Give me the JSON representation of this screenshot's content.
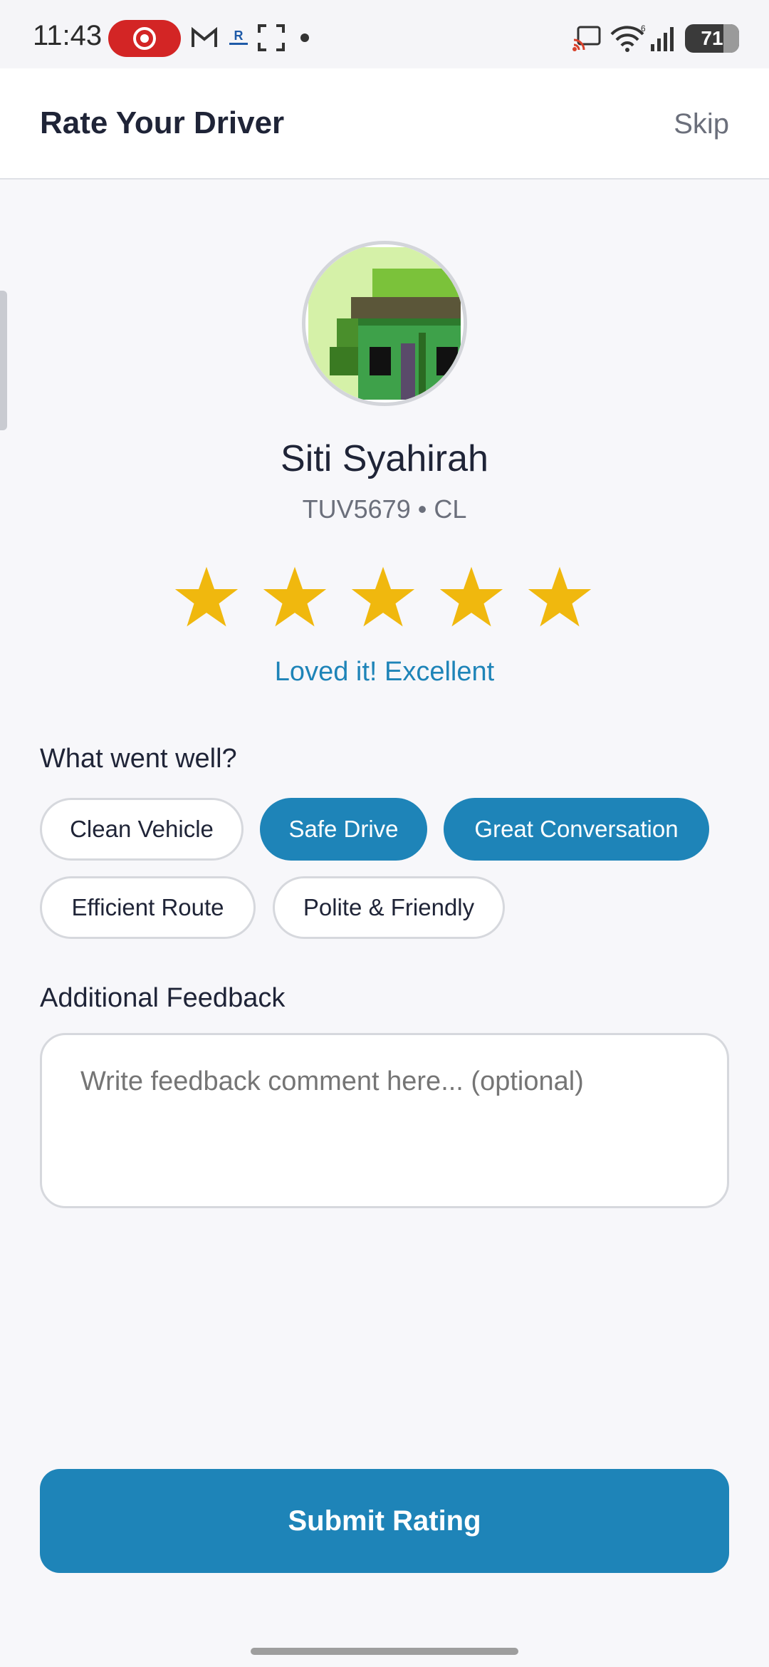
{
  "status_bar": {
    "time": "11:43",
    "battery_level": "71",
    "signal_label": "6",
    "icons": [
      "screen-record-icon",
      "gmail-icon",
      "app-r-icon",
      "screenshot-icon",
      "dot-icon",
      "cast-icon",
      "wifi-icon",
      "signal-icon",
      "battery-icon"
    ]
  },
  "header": {
    "title": "Rate Your Driver",
    "skip_label": "Skip"
  },
  "driver": {
    "name": "Siti Syahirah",
    "plate": "TUV5679 • CL",
    "avatar_icon": "pixel-avatar"
  },
  "rating": {
    "stars_selected": 5,
    "stars_total": 5,
    "label": "Loved it! Excellent",
    "star_color": "#F0B80E"
  },
  "what_went_well": {
    "title": "What went well?",
    "chips": [
      {
        "label": "Clean Vehicle",
        "selected": false
      },
      {
        "label": "Safe Drive",
        "selected": true
      },
      {
        "label": "Great Conversation",
        "selected": true
      },
      {
        "label": "Efficient Route",
        "selected": false
      },
      {
        "label": "Polite & Friendly",
        "selected": false
      }
    ]
  },
  "feedback": {
    "title": "Additional Feedback",
    "placeholder": "Write feedback comment here... (optional)",
    "value": ""
  },
  "submit": {
    "label": "Submit Rating"
  },
  "colors": {
    "accent": "#1E84B8",
    "text": "#1F2437",
    "muted": "#6B6F7B",
    "background": "#F7F7FA"
  }
}
